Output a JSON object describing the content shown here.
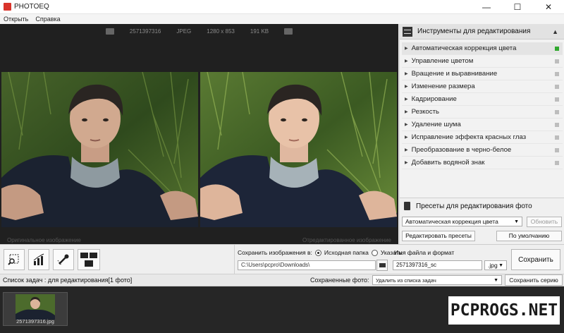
{
  "window": {
    "title": "PHOTOEQ",
    "minimize_glyph": "—",
    "maximize_glyph": "☐",
    "close_glyph": "✕"
  },
  "menu": {
    "items": [
      "Открыть",
      "Справка"
    ]
  },
  "image_info": {
    "filename": "2571397316",
    "format": "JPEG",
    "resolution": "1280 x 853",
    "size": "191 KB"
  },
  "viewer": {
    "original_caption": "Оригинальное изображение",
    "edited_caption": "Отредактированное изображение"
  },
  "tools_panel": {
    "title": "Инструменты для редактирования",
    "collapse_glyph": "▲",
    "items": [
      {
        "label": "Автоматическая коррекция цвета",
        "active": true
      },
      {
        "label": "Управление цветом",
        "active": false
      },
      {
        "label": "Вращение и выравнивание",
        "active": false
      },
      {
        "label": "Изменение размера",
        "active": false
      },
      {
        "label": "Кадрирование",
        "active": false
      },
      {
        "label": "Резкость",
        "active": false
      },
      {
        "label": "Удаление шума",
        "active": false
      },
      {
        "label": "Исправление эффекта красных глаз",
        "active": false
      },
      {
        "label": "Преобразование в черно-белое",
        "active": false
      },
      {
        "label": "Добавить водяной знак",
        "active": false
      }
    ],
    "active_color": "#31a92f"
  },
  "presets": {
    "title": "Пресеты для редактирования фото",
    "selected": "Автоматическая коррекция цвета",
    "update_button": "Обновить",
    "edit_button": "Редактировать пресеты",
    "default_button": "По умолчанию"
  },
  "save": {
    "save_to_label": "Сохранить изображения в:",
    "option_source": "Исходная папка",
    "option_custom": "Указать",
    "selected_option": "source",
    "path": "C:\\Users\\pcpro\\Downloads\\",
    "filename_label": "Имя файла и формат",
    "filename": "2571397316_sc",
    "extension": ".jpg",
    "save_button": "Сохранить"
  },
  "queue": {
    "label": "Список задач : для редактирования[1 фото]",
    "saved_label": "Сохраненные фото:",
    "saved_option": "Удалить из списка задач",
    "save_series_button": "Сохранить серию",
    "items": [
      {
        "filename": "2571397316.jpg"
      }
    ]
  },
  "watermark": {
    "text": "PCPROGS.NET"
  }
}
